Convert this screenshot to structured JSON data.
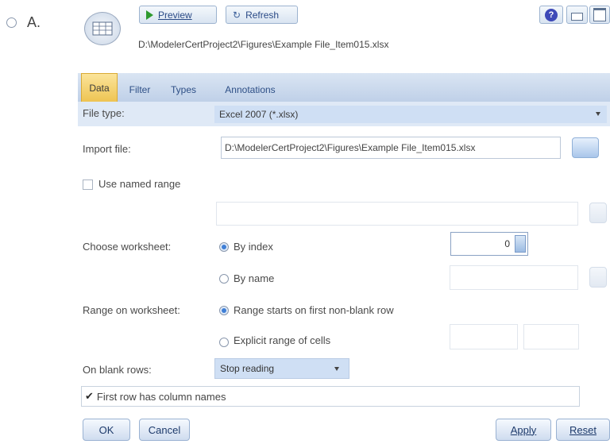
{
  "option": {
    "label": "A."
  },
  "toolbar": {
    "preview_label": "Preview",
    "refresh_label": "Refresh"
  },
  "file_path": "D:\\ModelerCertProject2\\Figures\\Example File_Item015.xlsx",
  "tabs": [
    {
      "label": "Data",
      "active": true
    },
    {
      "label": "Filter",
      "active": false
    },
    {
      "label": "Types",
      "active": false
    },
    {
      "label": "Annotations",
      "active": false
    }
  ],
  "form": {
    "file_type_label": "File type:",
    "file_type_value": "Excel 2007 (*.xlsx)",
    "import_file_label": "Import file:",
    "import_file_value": "D:\\ModelerCertProject2\\Figures\\Example File_Item015.xlsx",
    "use_named_range_label": "Use named range",
    "choose_worksheet_label": "Choose worksheet:",
    "by_index_label": "By index",
    "by_index_value": "0",
    "by_name_label": "By name",
    "range_label": "Range on worksheet:",
    "range_first_nonblank_label": "Range starts on first non-blank row",
    "explicit_range_label": "Explicit range of cells",
    "blank_rows_label": "On blank rows:",
    "blank_rows_value": "Stop reading",
    "first_row_names_label": "First row has column names",
    "first_row_names_checked": true
  },
  "buttons": {
    "ok": "OK",
    "cancel": "Cancel",
    "apply": "Apply",
    "reset": "Reset"
  },
  "colors": {
    "active_tab": "#f3d266",
    "tab_bar": "#c2d3ea",
    "dropdown": "#cfdff4"
  }
}
